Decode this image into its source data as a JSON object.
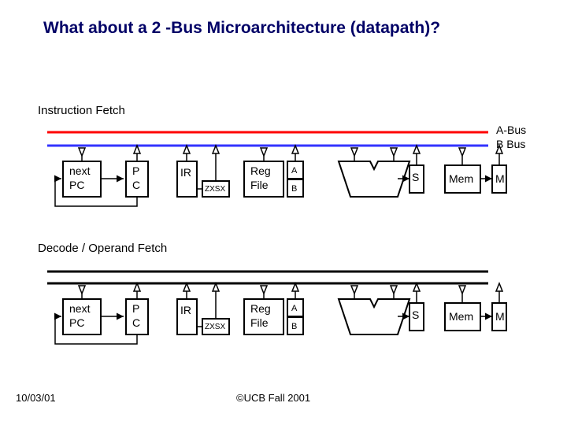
{
  "title": "What about a 2 -Bus Microarchitecture (datapath)?",
  "sections": {
    "fetch": "Instruction Fetch",
    "decode": "Decode / Operand Fetch"
  },
  "blocks": {
    "nextpc_l1": "next",
    "nextpc_l2": "PC",
    "pc_l1": "P",
    "pc_l2": "C",
    "ir": "IR",
    "zxsx": "ZXSX",
    "regfile_l1": "Reg",
    "regfile_l2": "File",
    "portA": "A",
    "portB": "B",
    "aluS": "S",
    "mem": "Mem",
    "mout": "M"
  },
  "bus_legend": {
    "a": "A-Bus",
    "b": "B Bus"
  },
  "footer": {
    "date": "10/03/01",
    "copyright": "©UCB Fall 2001"
  }
}
